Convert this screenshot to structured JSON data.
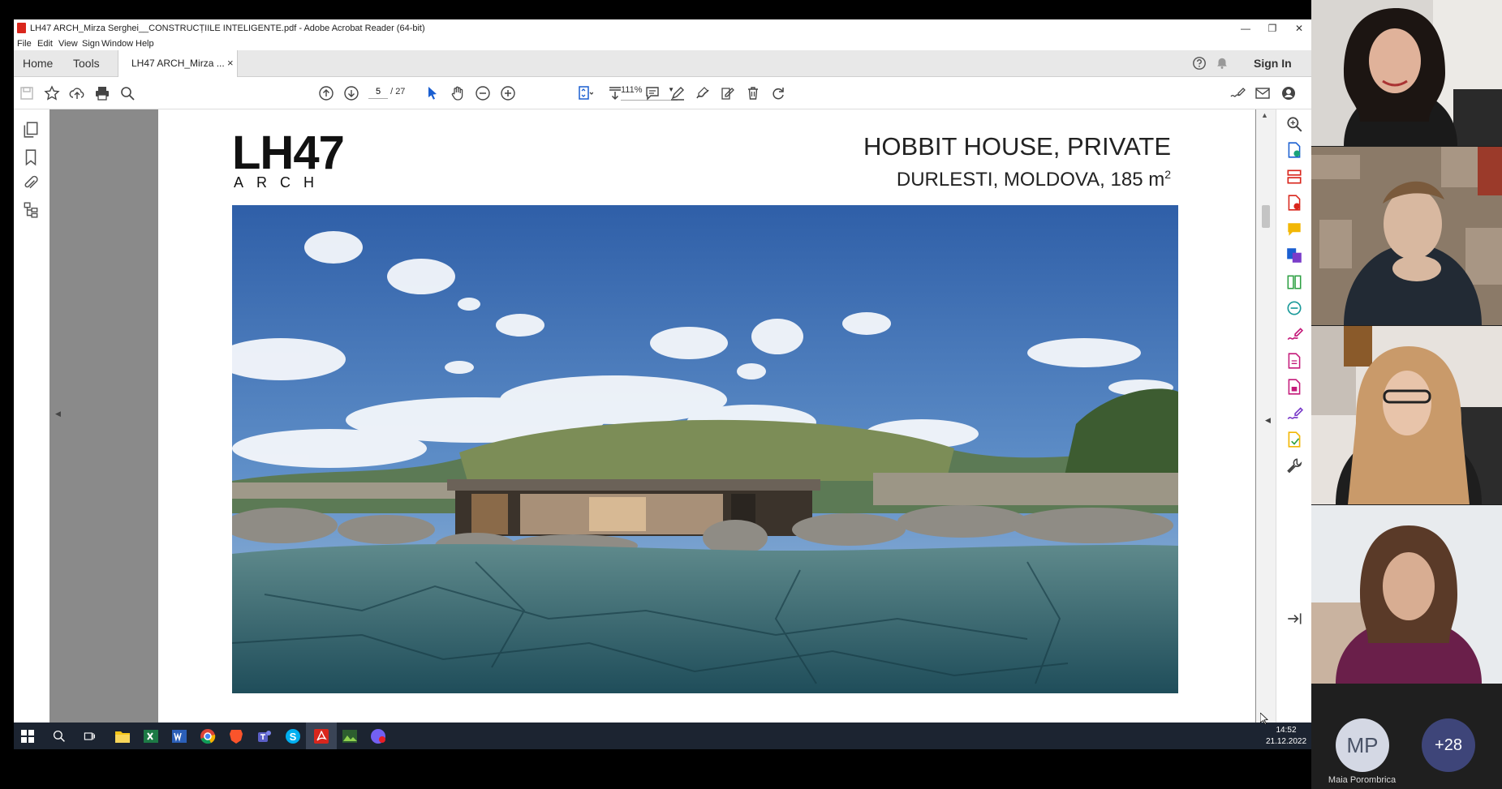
{
  "window": {
    "title": "LH47 ARCH_Mirza Serghei__CONSTRUCȚIILE INTELIGENTE.pdf - Adobe Acrobat Reader (64-bit)",
    "minimize": "—",
    "restore": "❐",
    "close": "✕"
  },
  "menu": [
    "File",
    "Edit",
    "View",
    "Sign",
    "Window",
    "Help"
  ],
  "tabs": {
    "home": "Home",
    "tools": "Tools",
    "document": "LH47 ARCH_Mirza ...",
    "close": "×",
    "sign_in": "Sign In"
  },
  "toolbar": {
    "current_page": "5",
    "page_sep": "/",
    "total_pages": "27",
    "zoom": "111%"
  },
  "document": {
    "logo_main": "LH47",
    "logo_sub": "ARCH",
    "title": "HOBBIT HOUSE, PRIVATE",
    "subtitle": "DURLESTI, MOLDOVA, 185 m",
    "subtitle_sup": "2"
  },
  "taskbar": {
    "time": "14:52",
    "date": "21.12.2022"
  },
  "call": {
    "avatar_initials": "MP",
    "avatar_name": "Maia Porombrica",
    "more_count": "+28"
  },
  "colors": {
    "acrobat_red": "#d9261c",
    "taskbar_bg": "#1c2431",
    "more_badge": "#3e4579"
  }
}
